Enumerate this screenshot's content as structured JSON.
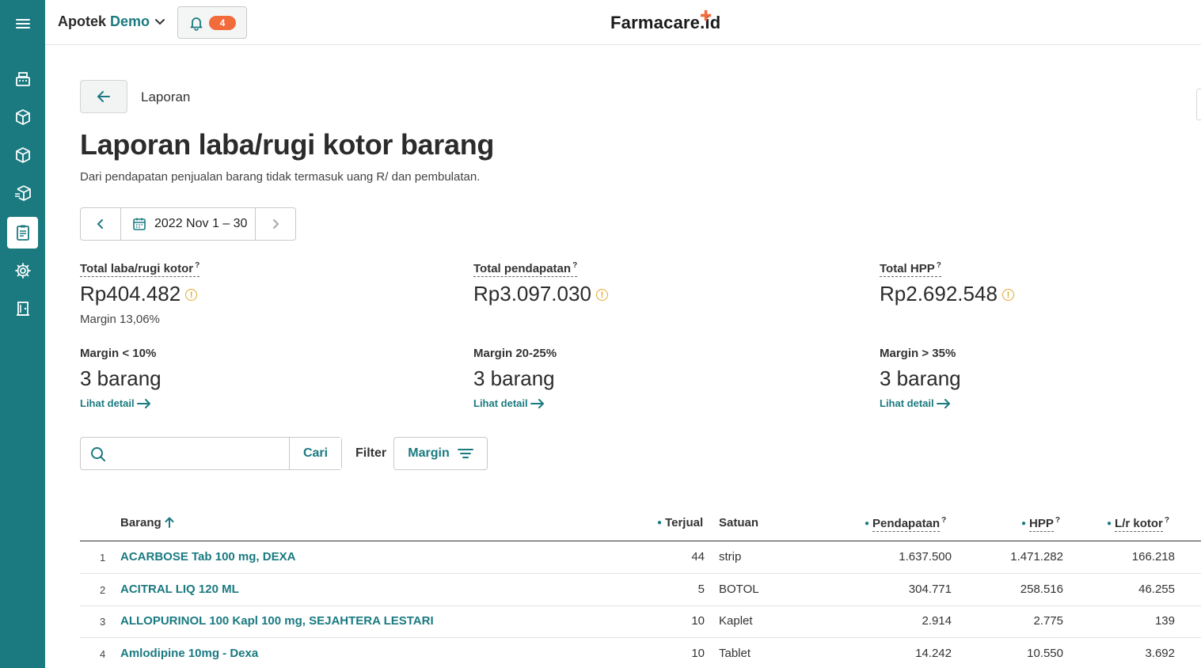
{
  "topbar": {
    "store_name": "Apotek",
    "store_suffix": "Demo",
    "notification_count": "4",
    "logo": "Farmacare.id"
  },
  "breadcrumb": {
    "label": "Laporan"
  },
  "page": {
    "title": "Laporan laba/rugi kotor barang",
    "subtitle": "Dari pendapatan penjualan barang tidak termasuk uang R/ dan pembulatan."
  },
  "date_range": "2022 Nov 1 – 30",
  "stats": [
    {
      "label": "Total laba/rugi kotor",
      "value": "Rp404.482",
      "sub": "Margin 13,06%"
    },
    {
      "label": "Total pendapatan",
      "value": "Rp3.097.030"
    },
    {
      "label": "Total HPP",
      "value": "Rp2.692.548"
    }
  ],
  "margins": [
    {
      "label": "Margin < 10%",
      "value": "3 barang",
      "link": "Lihat detail"
    },
    {
      "label": "Margin 20-25%",
      "value": "3 barang",
      "link": "Lihat detail"
    },
    {
      "label": "Margin > 35%",
      "value": "3 barang",
      "link": "Lihat detail"
    }
  ],
  "search": {
    "placeholder": "",
    "button": "Cari"
  },
  "filter": {
    "label": "Filter",
    "button": "Margin"
  },
  "table": {
    "columns": {
      "barang": "Barang",
      "terjual": "Terjual",
      "satuan": "Satuan",
      "pendapatan": "Pendapatan",
      "hpp": "HPP",
      "lr": "L/r kotor"
    },
    "rows": [
      {
        "no": "1",
        "name": "ACARBOSE Tab 100 mg, DEXA",
        "sold": "44",
        "unit": "strip",
        "revenue": "1.637.500",
        "hpp": "1.471.282",
        "lr": "166.218"
      },
      {
        "no": "2",
        "name": "ACITRAL LIQ 120 ML",
        "sold": "5",
        "unit": "BOTOL",
        "revenue": "304.771",
        "hpp": "258.516",
        "lr": "46.255"
      },
      {
        "no": "3",
        "name": "ALLOPURINOL 100 Kapl 100 mg, SEJAHTERA LESTARI",
        "sold": "10",
        "unit": "Kaplet",
        "revenue": "2.914",
        "hpp": "2.775",
        "lr": "139"
      },
      {
        "no": "4",
        "name": "Amlodipine 10mg - Dexa",
        "sold": "10",
        "unit": "Tablet",
        "revenue": "14.242",
        "hpp": "10.550",
        "lr": "3.692"
      }
    ]
  },
  "colors": {
    "accent": "#1a7a80",
    "badge": "#f26b3a",
    "warning": "#e0a72c"
  }
}
